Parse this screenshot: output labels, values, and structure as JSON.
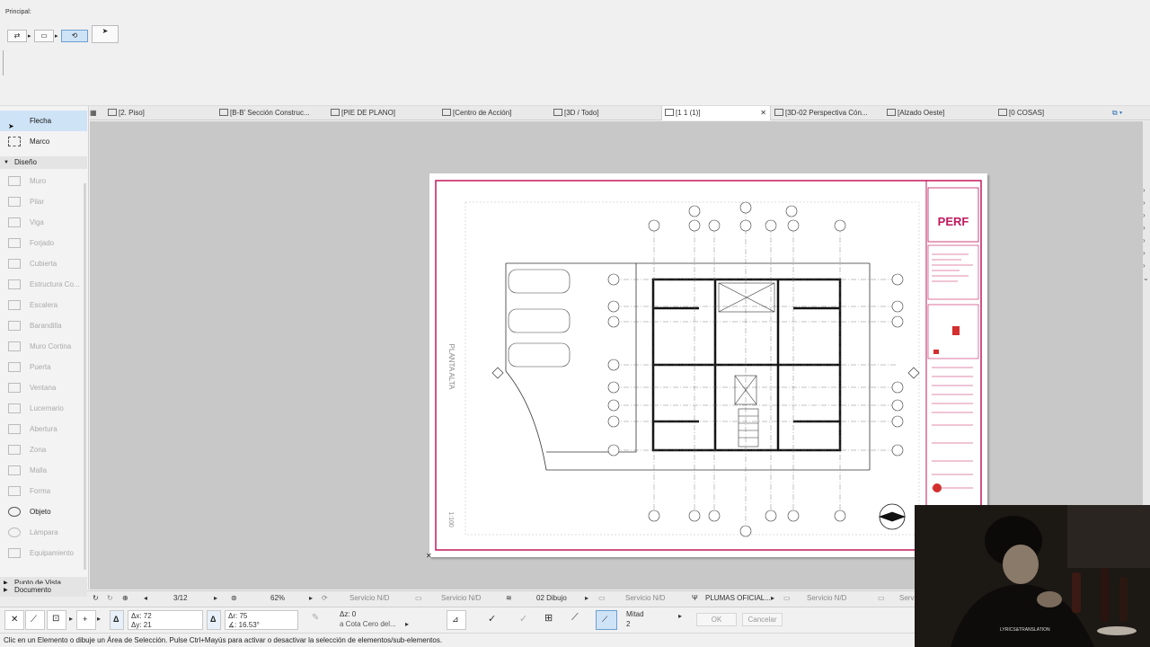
{
  "toolbar": {
    "principal_label": "Principal:"
  },
  "tabs": [
    {
      "label": "[2. Piso]"
    },
    {
      "label": "[B-B' Sección Construc..."
    },
    {
      "label": "[PIE DE PLANO]"
    },
    {
      "label": "[Centro de Acción]"
    },
    {
      "label": "[3D / Todo]"
    },
    {
      "label": "[1 1 (1)]"
    },
    {
      "label": "[3D-02 Perspectiva Cón..."
    },
    {
      "label": "[Alzado Oeste]"
    },
    {
      "label": "[0 COSAS]"
    }
  ],
  "toolbox": {
    "flecha": "Flecha",
    "marco": "Marco",
    "diseno_section": "Diseño",
    "tools": [
      "Muro",
      "Pilar",
      "Viga",
      "Forjado",
      "Cubierta",
      "Estructura Co...",
      "Escalera",
      "Barandilla",
      "Muro Cortina",
      "Puerta",
      "Ventana",
      "Lucernario",
      "Abertura",
      "Zona",
      "Malla",
      "Forma",
      "Objeto",
      "Lámpara",
      "Equipamiento"
    ],
    "punto_de_vista": "Punto de Vista",
    "documento": "Documento"
  },
  "navbar": {
    "page": "3/12",
    "zoom": "62%",
    "servicio_1": "Servicio N/D",
    "servicio_2": "Servicio N/D",
    "layer": "02 Dibujo",
    "servicio_3": "Servicio N/D",
    "pen": "PLUMAS OFICIAL...",
    "servicio_4": "Servicio N/D",
    "servicio_5": "Servi"
  },
  "infobox": {
    "dx": "Δx: 72",
    "dy": "Δy: 21",
    "dr": "Δr: 75",
    "da": "∡: 16.53°",
    "dz": "Δz: 0",
    "ref": "a Cota Cero del...",
    "mitad": "Mitad",
    "mitad_val": "2",
    "ok": "OK",
    "cancel": "Cancelar"
  },
  "drawing": {
    "vertical_label": "PLANTA ALTA",
    "scale_label": "1:100",
    "logo": "PERF"
  },
  "status_text": "Clic en un Elemento o dibuje un Área de Selección. Pulse Ctrl+Mayús para activar o desactivar la selección de elementos/sub-elementos.",
  "webcam": {
    "caption": "LYRICS&TRANSLATION"
  },
  "colors": {
    "sheet_border": "#c2185b",
    "selection": "#cfe3f7"
  }
}
